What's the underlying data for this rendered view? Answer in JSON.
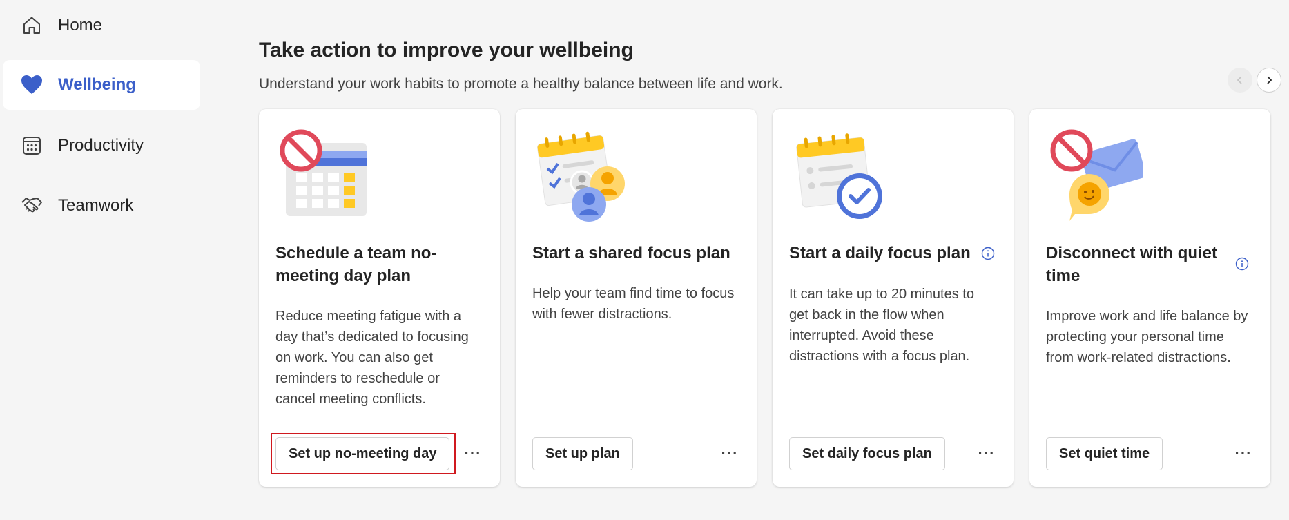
{
  "sidebar": {
    "items": [
      {
        "label": "Home",
        "icon": "home-icon",
        "active": false
      },
      {
        "label": "Wellbeing",
        "icon": "heart-icon",
        "active": true
      },
      {
        "label": "Productivity",
        "icon": "calendar-grid-icon",
        "active": false
      },
      {
        "label": "Teamwork",
        "icon": "handshake-icon",
        "active": false
      }
    ]
  },
  "main": {
    "title": "Take action to improve your wellbeing",
    "subtitle": "Understand your work habits to promote a healthy balance between life and work.",
    "pager": {
      "prev_icon": "chevron-left-icon",
      "next_icon": "chevron-right-icon"
    },
    "cards": [
      {
        "title": "Schedule a team no-meeting day plan",
        "description": "Reduce meeting fatigue with a day that’s dedicated to focusing on work. You can also get reminders to reschedule or cancel meeting conflicts.",
        "button": "Set up no-meeting day",
        "more": "···",
        "illustration": "no-meeting-calendar-illustration",
        "highlighted": true
      },
      {
        "title": "Start a shared focus plan",
        "description": "Help your team find time to focus with fewer distractions.",
        "button": "Set up plan",
        "more": "···",
        "illustration": "shared-focus-illustration"
      },
      {
        "title": "Start a daily focus plan",
        "description": "It can take up to 20 minutes to get back in the flow when interrupted. Avoid these distractions with a focus plan.",
        "button": "Set daily focus plan",
        "more": "···",
        "illustration": "daily-focus-illustration",
        "info_icon": "info-icon"
      },
      {
        "title": "Disconnect with quiet time",
        "description": "Improve work and life balance by protecting your personal time from work-related distractions.",
        "button": "Set quiet time",
        "more": "···",
        "illustration": "quiet-time-illustration",
        "info_icon": "info-icon"
      }
    ]
  },
  "colors": {
    "accent": "#3b5fc9",
    "highlight": "#d0191f",
    "background": "#f5f5f5"
  }
}
